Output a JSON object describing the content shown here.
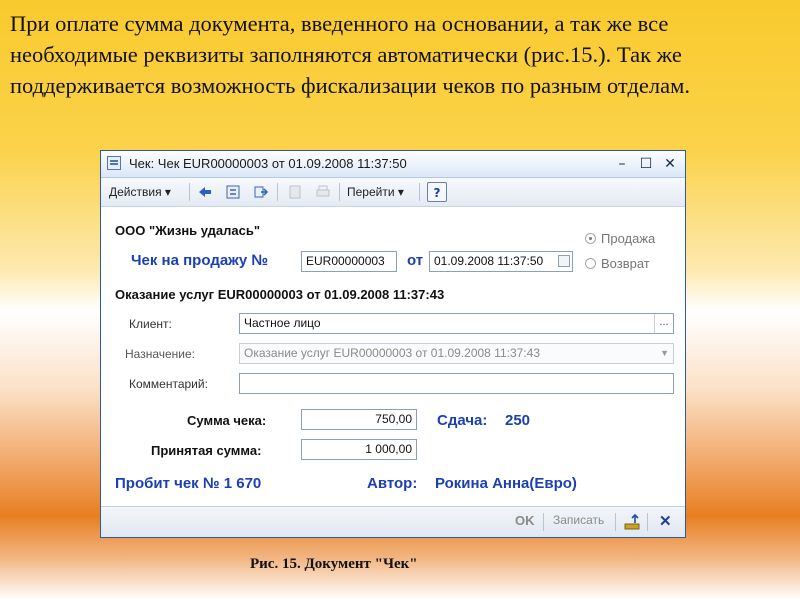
{
  "slide": {
    "intro": "При оплате сумма документа, введенного на основании, а так же все необходимые реквизиты заполняются автоматически (рис.15.). Так же поддерживается возможность фискализации чеков по разным отделам.",
    "caption": "Рис. 15. Документ \"Чек\""
  },
  "window": {
    "title": "Чек: Чек EUR00000003 от 01.09.2008 11:37:50",
    "minimize": "–",
    "maximize": "☐",
    "close": "✕"
  },
  "toolbar": {
    "actions": "Действия ▾",
    "goto": "Перейти ▾",
    "help": "?"
  },
  "form": {
    "org": "ООО \"Жизнь удалась\"",
    "receipt_label": "Чек на продажу №",
    "receipt_number": "EUR00000003",
    "from_label": "от",
    "receipt_date": "01.09.2008 11:37:50",
    "radio_sale": "Продажа",
    "radio_return": "Возврат",
    "basis": "Оказание услуг EUR00000003 от 01.09.2008 11:37:43",
    "client_label": "Клиент:",
    "client_value": "Частное лицо",
    "purpose_label": "Назначение:",
    "purpose_value": "Оказание услуг EUR00000003 от 01.09.2008 11:37:43",
    "comment_label": "Комментарий:",
    "comment_value": "",
    "sum_label": "Сумма чека:",
    "sum_value": "750,00",
    "change_label": "Сдача:",
    "change_value": "250",
    "accepted_label": "Принятая сумма:",
    "accepted_value": "1 000,00",
    "printed_label": "Пробит чек № 1 670",
    "author_label": "Автор:",
    "author_value": "Рокина Анна(Евро)"
  },
  "footer": {
    "ok": "OK",
    "save": "Записать",
    "close": "✕"
  },
  "colors": {
    "accent_blue": "#1c3fb3",
    "window_border": "#2c5aa8"
  }
}
